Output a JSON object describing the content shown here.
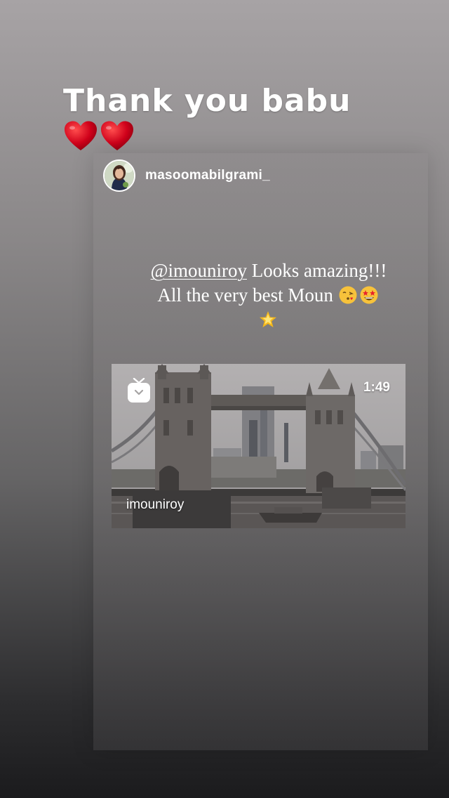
{
  "overlay": {
    "title": "Thank you babu",
    "hearts": [
      "red-heart",
      "red-heart"
    ]
  },
  "shared_post": {
    "username": "masoomabilgrami_",
    "caption": {
      "mention": "@imouniroy",
      "text_after_mention": " Looks amazing!!! All the very best Moun ",
      "emojis": [
        "face-blowing-kiss",
        "star-struck",
        "glowing-star"
      ]
    },
    "video": {
      "duration": "1:49",
      "author": "imouniroy",
      "icon": "igtv-icon"
    }
  },
  "colors": {
    "heart": "#d0021b",
    "text": "#ffffff"
  }
}
